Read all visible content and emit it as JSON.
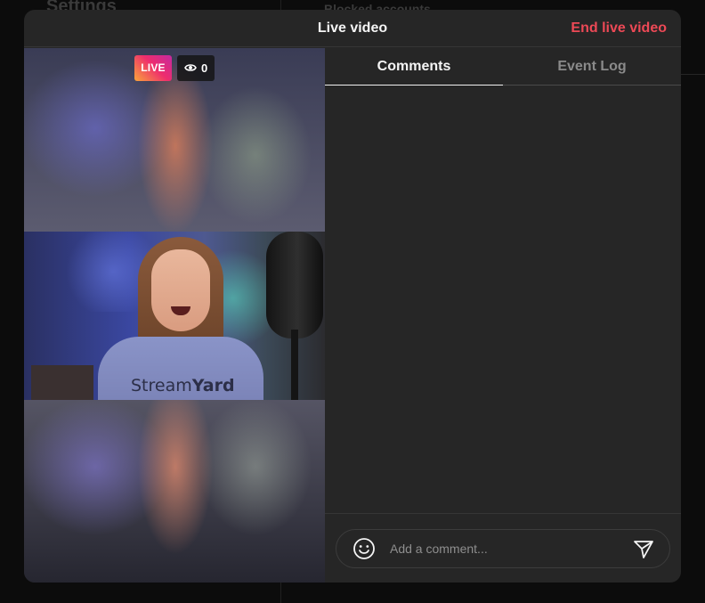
{
  "background": {
    "left_heading": "Settings",
    "right_heading": "Blocked accounts"
  },
  "modal": {
    "title": "Live video",
    "end_button": "End live video"
  },
  "video": {
    "live_label": "LIVE",
    "viewer_count": "0",
    "viewer_icon": "eye-icon",
    "shirt_text_regular": "Stream",
    "shirt_text_bold": "Yard"
  },
  "tabs": [
    {
      "label": "Comments",
      "active": true
    },
    {
      "label": "Event Log",
      "active": false
    }
  ],
  "comments": [],
  "comment_input": {
    "placeholder": "Add a comment...",
    "value": "",
    "emoji_icon": "emoji-icon",
    "send_icon": "send-icon"
  },
  "colors": {
    "accent_red": "#ed4956",
    "panel_bg": "#262626",
    "live_gradient_start": "#f9a53a",
    "live_gradient_end": "#c529a0"
  }
}
